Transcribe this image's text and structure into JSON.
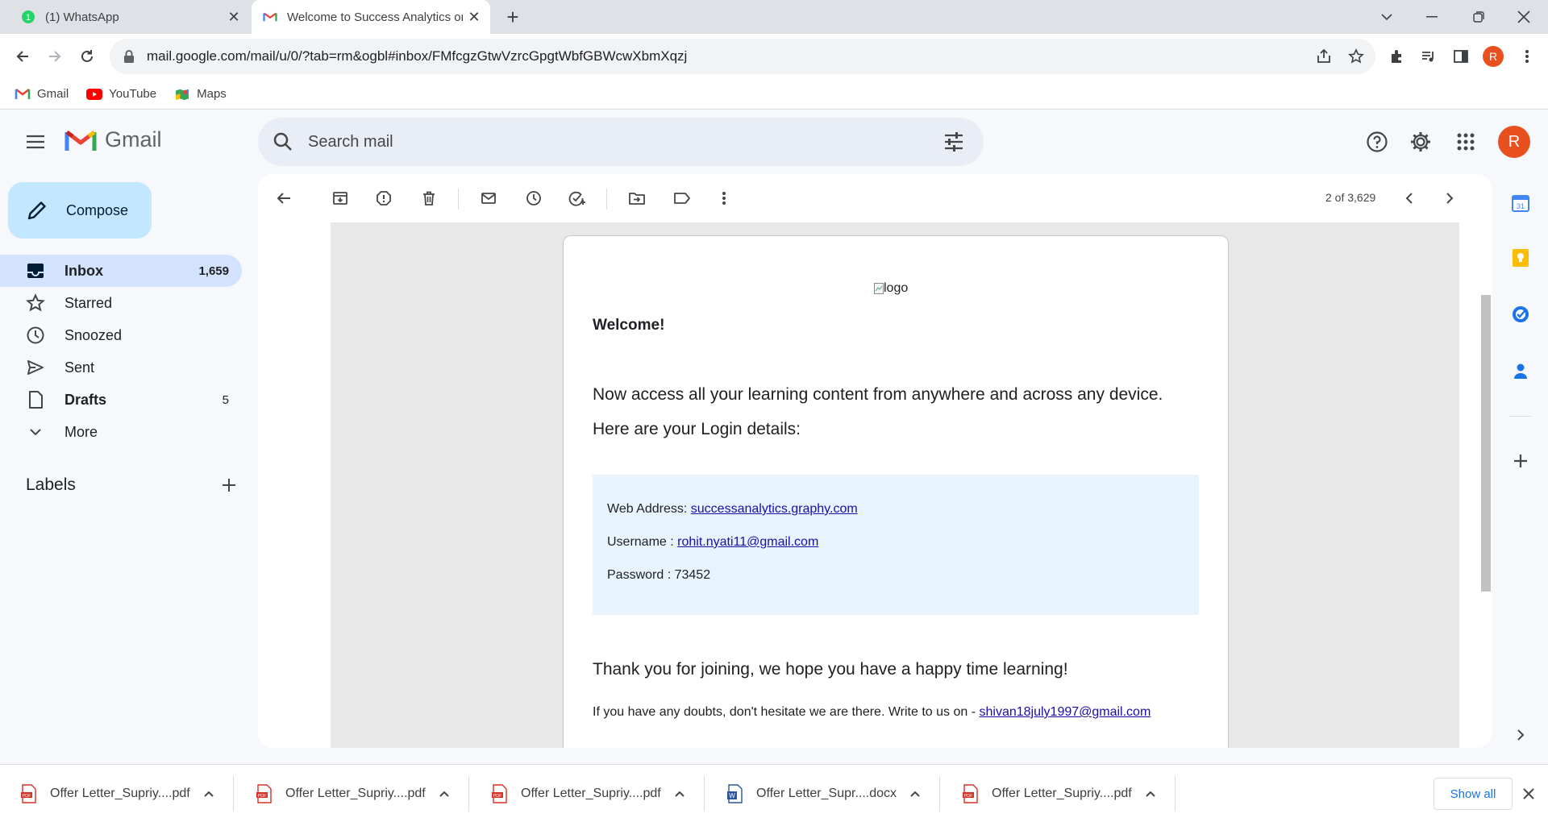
{
  "browser": {
    "tabs": [
      {
        "title": "(1) WhatsApp",
        "badge": "1",
        "active": false
      },
      {
        "title": "Welcome to Success Analytics on",
        "active": true
      }
    ],
    "url": "mail.google.com/mail/u/0/?tab=rm&ogbl#inbox/FMfcgzGtwVzrcGpgtWbfGBWcwXbmXqzj",
    "profile_initial": "R",
    "bookmarks": [
      {
        "label": "Gmail",
        "icon": "gmail-icon"
      },
      {
        "label": "YouTube",
        "icon": "youtube-icon"
      },
      {
        "label": "Maps",
        "icon": "maps-icon"
      }
    ]
  },
  "gmail": {
    "product_name": "Gmail",
    "search_placeholder": "Search mail",
    "avatar_initial": "R",
    "compose_label": "Compose",
    "nav": [
      {
        "label": "Inbox",
        "count": "1,659",
        "icon": "inbox-icon",
        "active": true
      },
      {
        "label": "Starred",
        "count": "",
        "icon": "star-icon"
      },
      {
        "label": "Snoozed",
        "count": "",
        "icon": "clock-icon"
      },
      {
        "label": "Sent",
        "count": "",
        "icon": "send-icon"
      },
      {
        "label": "Drafts",
        "count": "5",
        "icon": "draft-icon"
      },
      {
        "label": "More",
        "count": "",
        "icon": "chevron-down-icon"
      }
    ],
    "labels_header": "Labels",
    "pager": "2 of 3,629"
  },
  "email": {
    "logo_alt": "logo",
    "welcome": "Welcome!",
    "line1": "Now access all your learning content from anywhere and across any device.",
    "line2": "Here are your Login details:",
    "web_address_label": "Web Address: ",
    "web_address": "successanalytics.graphy.com",
    "username_label": "Username : ",
    "username": "rohit.nyati11@gmail.com",
    "password_label": "Password : ",
    "password": "73452",
    "thanks": "Thank you for joining, we hope you have a happy time learning!",
    "doubts_text": "If you have any doubts, don't hesitate we are there. Write to us on - ",
    "contact_email": "shivan18july1997@gmail.com"
  },
  "downloads": {
    "items": [
      {
        "name": "Offer Letter_Supriy....pdf",
        "type": "pdf"
      },
      {
        "name": "Offer Letter_Supriy....pdf",
        "type": "pdf"
      },
      {
        "name": "Offer Letter_Supriy....pdf",
        "type": "pdf"
      },
      {
        "name": "Offer Letter_Supr....docx",
        "type": "docx"
      },
      {
        "name": "Offer Letter_Supriy....pdf",
        "type": "pdf"
      }
    ],
    "show_all_label": "Show all"
  },
  "colors": {
    "accent_blue": "#1a73e8",
    "compose_bg": "#c2e7ff",
    "active_nav_bg": "#d3e3fd",
    "avatar_orange": "#e8501f"
  }
}
